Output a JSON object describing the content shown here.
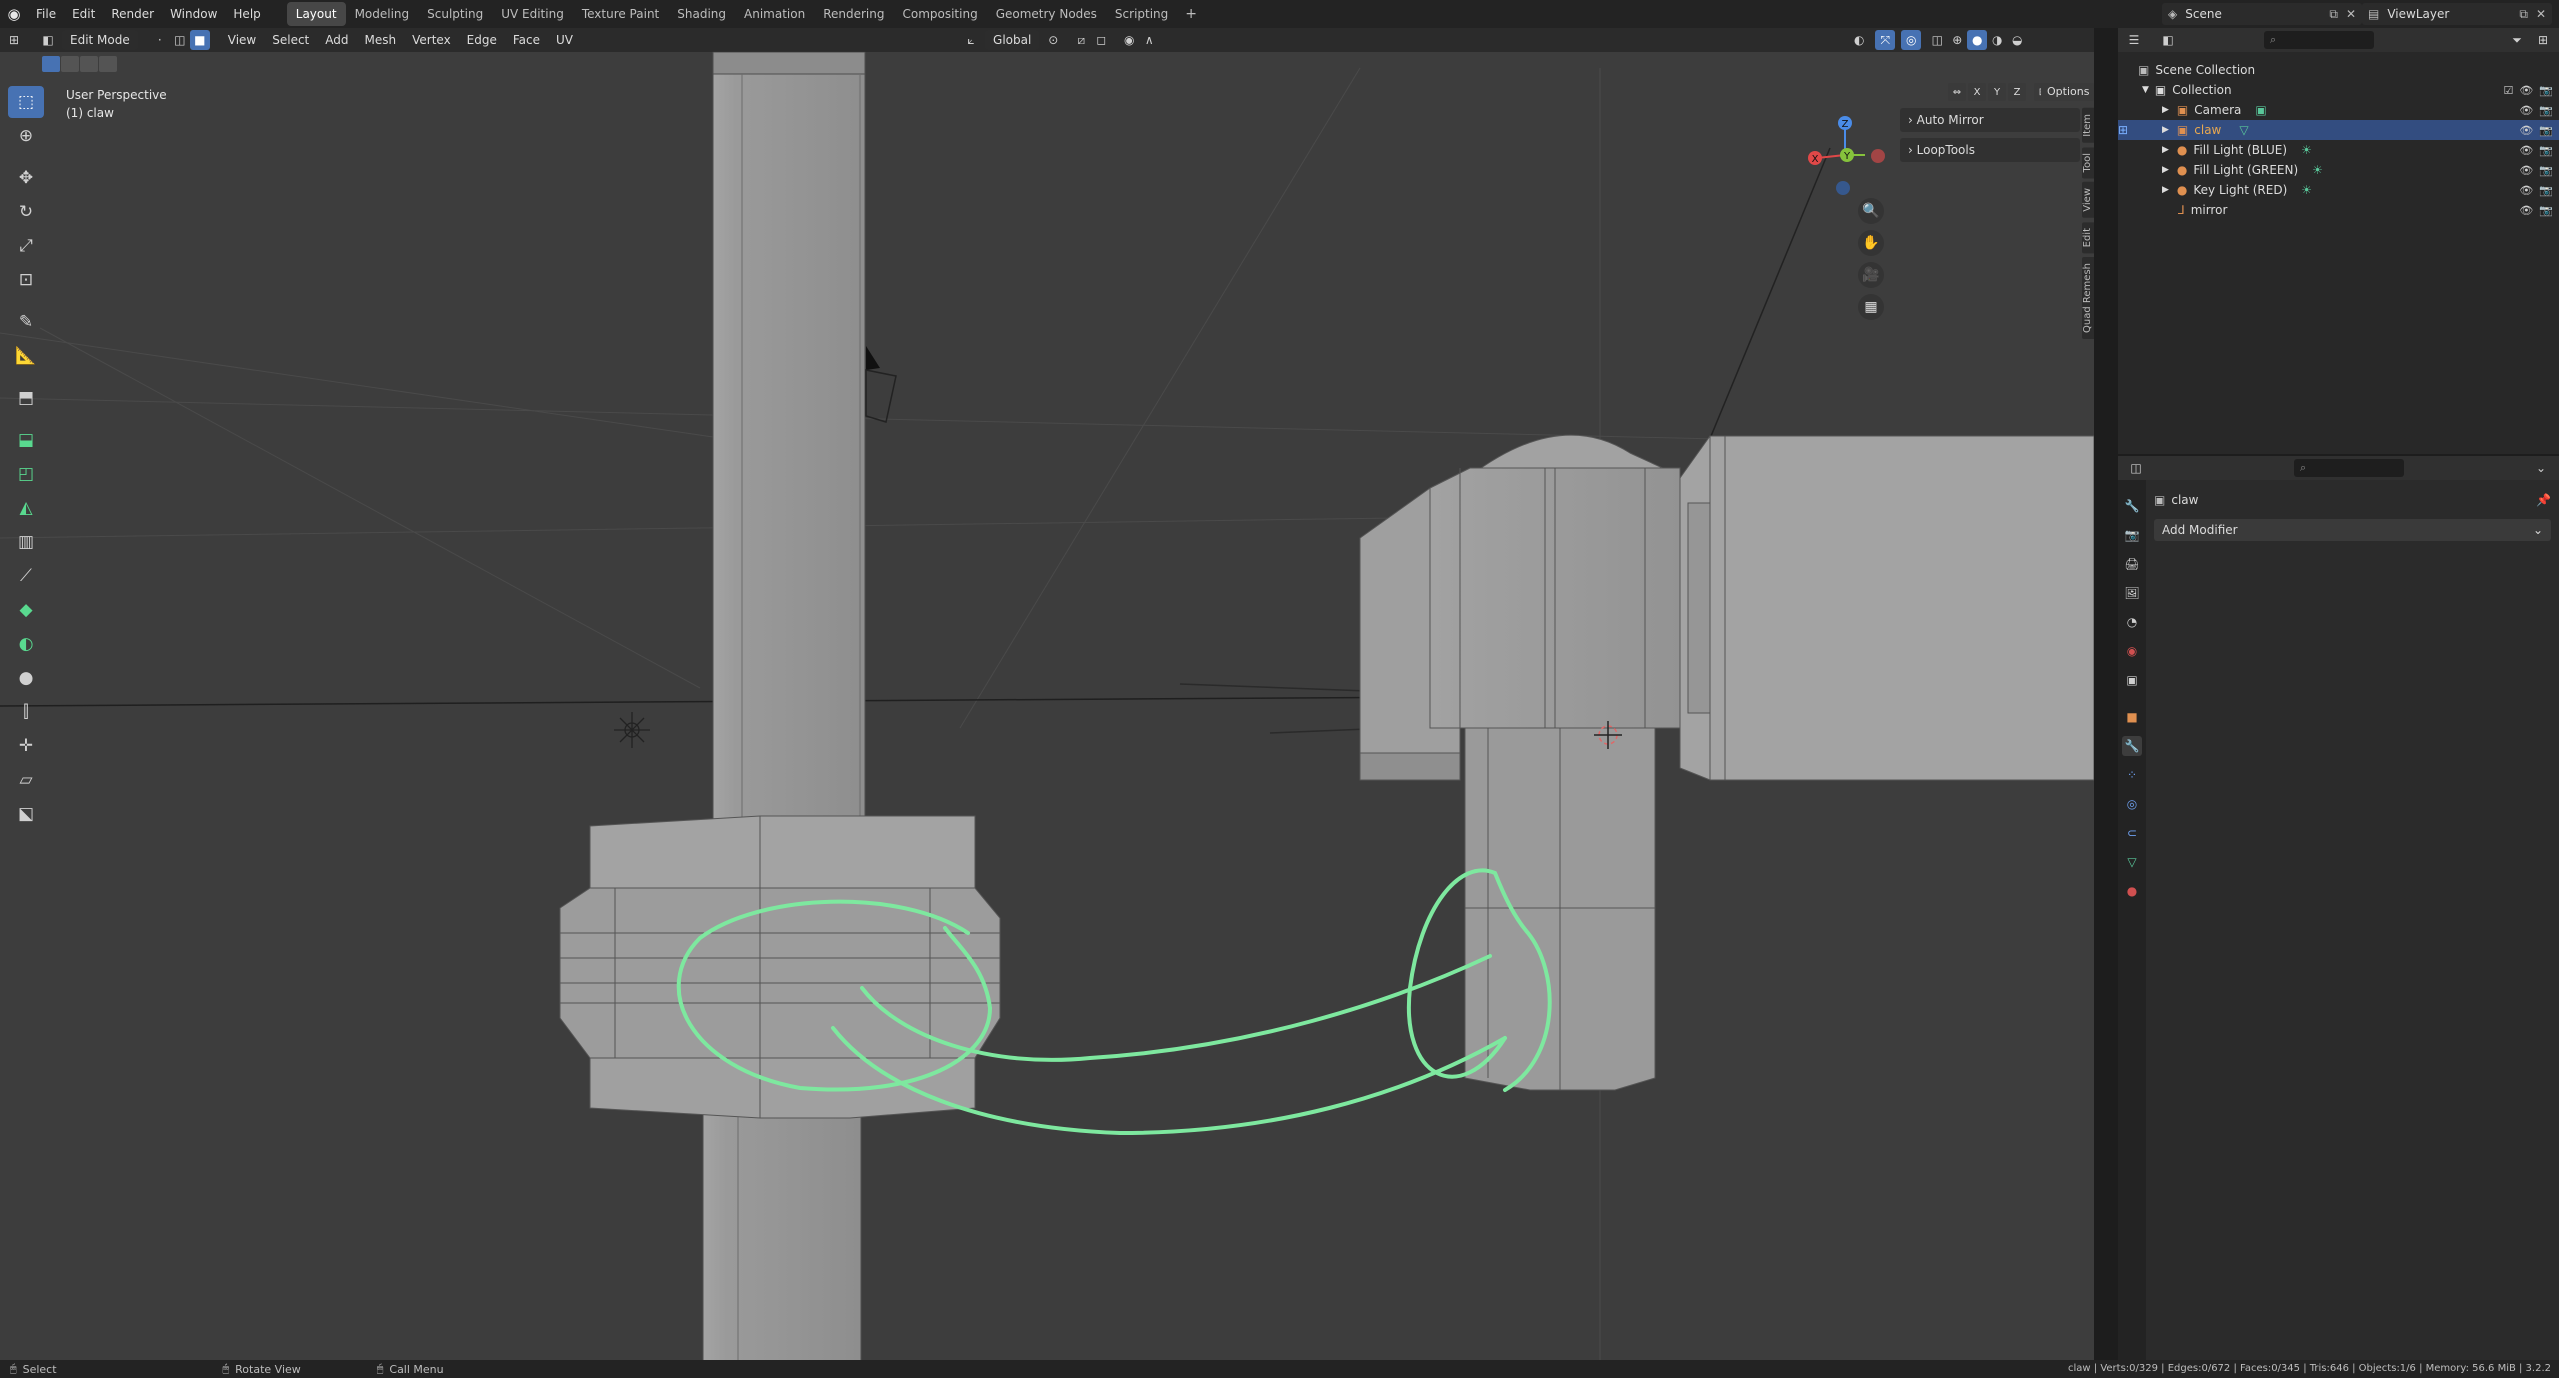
{
  "topbar": {
    "menus": [
      "File",
      "Edit",
      "Render",
      "Window",
      "Help"
    ],
    "workspaces": [
      "Layout",
      "Modeling",
      "Sculpting",
      "UV Editing",
      "Texture Paint",
      "Shading",
      "Animation",
      "Rendering",
      "Compositing",
      "Geometry Nodes",
      "Scripting"
    ],
    "active_workspace": "Layout",
    "add_workspace": "+",
    "scene": "Scene",
    "view_layer": "ViewLayer"
  },
  "viewport_header": {
    "mode": "Edit Mode",
    "menus": [
      "View",
      "Select",
      "Add",
      "Mesh",
      "Vertex",
      "Edge",
      "Face",
      "UV"
    ],
    "transform_orientation": "Global",
    "options": "Options",
    "axes": [
      "X",
      "Y",
      "Z"
    ]
  },
  "viewport": {
    "perspective": "User Perspective",
    "object_label": "(1) claw",
    "last_operator_panels": [
      "Auto Mirror",
      "LoopTools"
    ],
    "side_tabs": [
      "Item",
      "Tool",
      "View",
      "Edit",
      "Quad Remesh"
    ],
    "gizmo": {
      "x": "X",
      "y": "Y",
      "z": "Z"
    },
    "stroke_color": "#7ee89f",
    "mesh_color": "#9a9a9a",
    "background_color": "#3d3d3d"
  },
  "outliner": {
    "root": "Scene Collection",
    "collection": "Collection",
    "items": [
      {
        "name": "Camera",
        "icon": "camera-icon",
        "selected": false
      },
      {
        "name": "claw",
        "icon": "grease-pencil-icon",
        "selected": true
      },
      {
        "name": "Fill Light (BLUE)",
        "icon": "light-icon",
        "selected": false
      },
      {
        "name": "Fill Light (GREEN)",
        "icon": "light-icon",
        "selected": false
      },
      {
        "name": "Key Light (RED)",
        "icon": "light-icon",
        "selected": false
      },
      {
        "name": "mirror",
        "icon": "empty-icon",
        "selected": false
      }
    ]
  },
  "properties": {
    "object_name": "claw",
    "add_modifier": "Add Modifier",
    "tabs": [
      "tool-icon",
      "render-icon",
      "output-icon",
      "view-layer-icon",
      "scene-icon",
      "world-icon",
      "collection-icon",
      "object-icon",
      "modifier-icon",
      "particles-icon",
      "physics-icon",
      "constraints-icon",
      "data-icon",
      "material-icon"
    ],
    "active_tab": "modifier-icon"
  },
  "statusbar": {
    "select": "Select",
    "rotate": "Rotate View",
    "call_menu": "Call Menu",
    "stats": "claw | Verts:0/329 | Edges:0/672 | Faces:0/345 | Tris:646 | Objects:1/6 | Memory: 56.6 MiB | 3.2.2"
  }
}
